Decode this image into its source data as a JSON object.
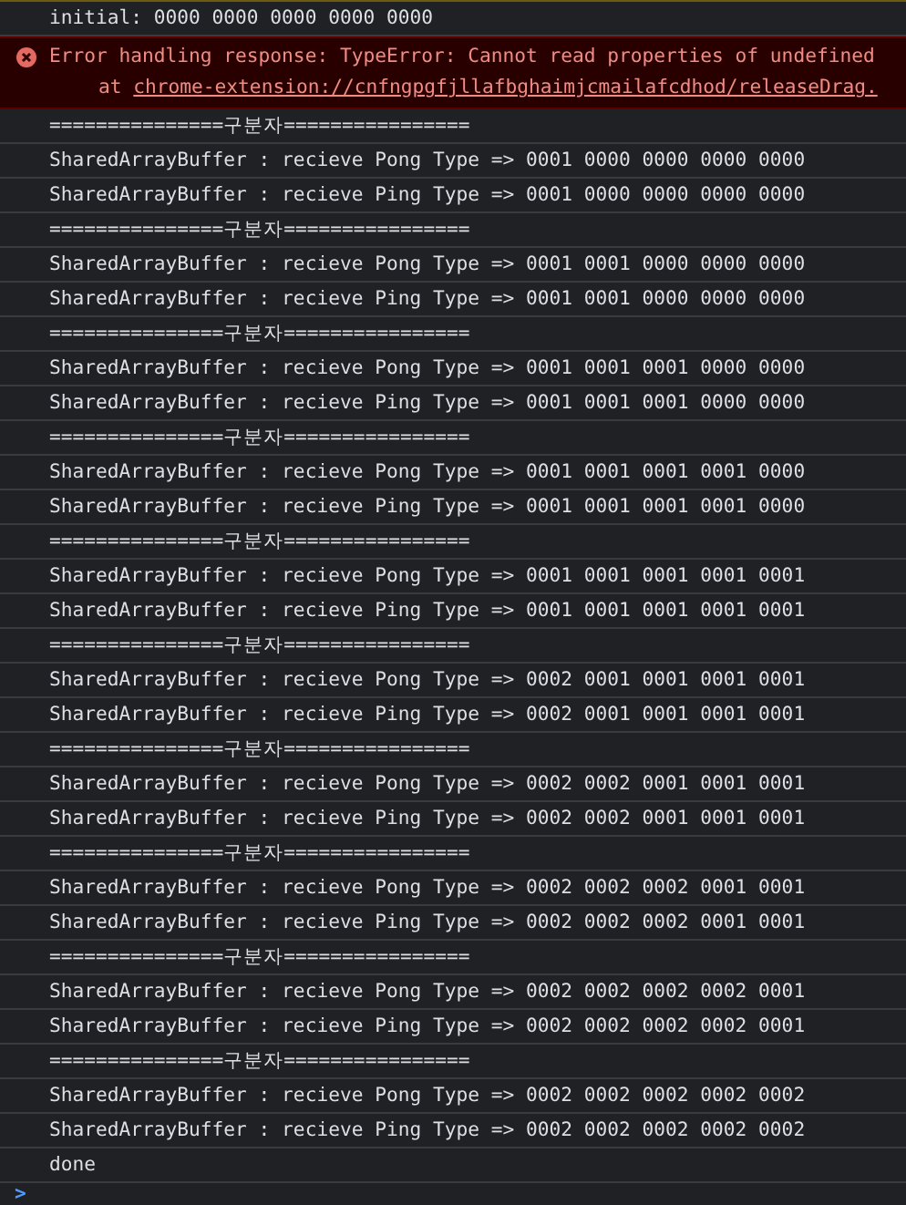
{
  "console": {
    "entries": [
      {
        "kind": "log",
        "text": "initial: 0000 0000 0000 0000 0000"
      },
      {
        "kind": "error",
        "text": "Error handling response: TypeError: Cannot read properties of undefined",
        "stack_prefix": "at",
        "stack_link": "chrome-extension://cnfngpgfjllafbghaimjcmailafcdhod/releaseDrag."
      },
      {
        "kind": "log",
        "text": "===============구분자================"
      },
      {
        "kind": "log",
        "text": "SharedArrayBuffer : recieve Pong Type => 0001 0000 0000 0000 0000"
      },
      {
        "kind": "log",
        "text": "SharedArrayBuffer : recieve Ping Type => 0001 0000 0000 0000 0000"
      },
      {
        "kind": "log",
        "text": "===============구분자================"
      },
      {
        "kind": "log",
        "text": "SharedArrayBuffer : recieve Pong Type => 0001 0001 0000 0000 0000"
      },
      {
        "kind": "log",
        "text": "SharedArrayBuffer : recieve Ping Type => 0001 0001 0000 0000 0000"
      },
      {
        "kind": "log",
        "text": "===============구분자================"
      },
      {
        "kind": "log",
        "text": "SharedArrayBuffer : recieve Pong Type => 0001 0001 0001 0000 0000"
      },
      {
        "kind": "log",
        "text": "SharedArrayBuffer : recieve Ping Type => 0001 0001 0001 0000 0000"
      },
      {
        "kind": "log",
        "text": "===============구분자================"
      },
      {
        "kind": "log",
        "text": "SharedArrayBuffer : recieve Pong Type => 0001 0001 0001 0001 0000"
      },
      {
        "kind": "log",
        "text": "SharedArrayBuffer : recieve Ping Type => 0001 0001 0001 0001 0000"
      },
      {
        "kind": "log",
        "text": "===============구분자================"
      },
      {
        "kind": "log",
        "text": "SharedArrayBuffer : recieve Pong Type => 0001 0001 0001 0001 0001"
      },
      {
        "kind": "log",
        "text": "SharedArrayBuffer : recieve Ping Type => 0001 0001 0001 0001 0001"
      },
      {
        "kind": "log",
        "text": "===============구분자================"
      },
      {
        "kind": "log",
        "text": "SharedArrayBuffer : recieve Pong Type => 0002 0001 0001 0001 0001"
      },
      {
        "kind": "log",
        "text": "SharedArrayBuffer : recieve Ping Type => 0002 0001 0001 0001 0001"
      },
      {
        "kind": "log",
        "text": "===============구분자================"
      },
      {
        "kind": "log",
        "text": "SharedArrayBuffer : recieve Pong Type => 0002 0002 0001 0001 0001"
      },
      {
        "kind": "log",
        "text": "SharedArrayBuffer : recieve Ping Type => 0002 0002 0001 0001 0001"
      },
      {
        "kind": "log",
        "text": "===============구분자================"
      },
      {
        "kind": "log",
        "text": "SharedArrayBuffer : recieve Pong Type => 0002 0002 0002 0001 0001"
      },
      {
        "kind": "log",
        "text": "SharedArrayBuffer : recieve Ping Type => 0002 0002 0002 0001 0001"
      },
      {
        "kind": "log",
        "text": "===============구분자================"
      },
      {
        "kind": "log",
        "text": "SharedArrayBuffer : recieve Pong Type => 0002 0002 0002 0002 0001"
      },
      {
        "kind": "log",
        "text": "SharedArrayBuffer : recieve Ping Type => 0002 0002 0002 0002 0001"
      },
      {
        "kind": "log",
        "text": "===============구분자================"
      },
      {
        "kind": "log",
        "text": "SharedArrayBuffer : recieve Pong Type => 0002 0002 0002 0002 0002"
      },
      {
        "kind": "log",
        "text": "SharedArrayBuffer : recieve Ping Type => 0002 0002 0002 0002 0002"
      },
      {
        "kind": "log",
        "text": "done"
      }
    ],
    "prompt": ">"
  }
}
